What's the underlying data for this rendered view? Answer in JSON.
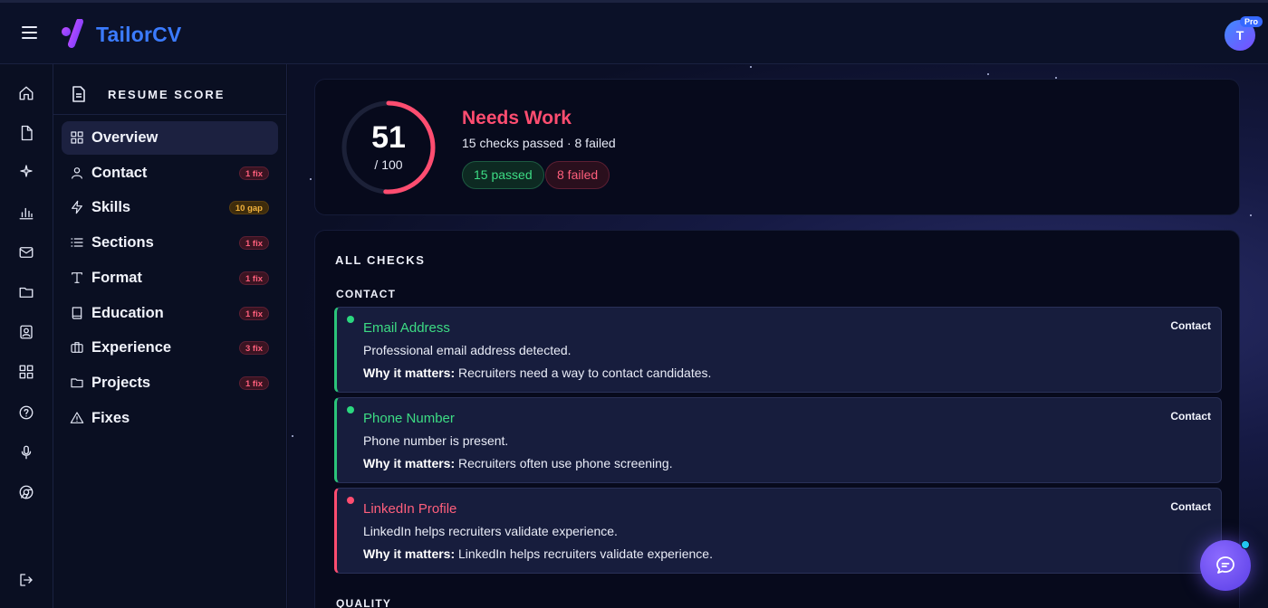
{
  "app": {
    "brand": "TailorCV",
    "user_initial": "T",
    "plan_badge": "Pro",
    "accent": "#3b7bff"
  },
  "sidebar": {
    "title": "RESUME SCORE",
    "items": [
      {
        "label": "Overview",
        "icon": "grid-icon",
        "badge": ""
      },
      {
        "label": "Contact",
        "icon": "user-icon",
        "badge": "1 fix"
      },
      {
        "label": "Skills",
        "icon": "zap-icon",
        "badge": "10 gap"
      },
      {
        "label": "Sections",
        "icon": "list-icon",
        "badge": "1 fix"
      },
      {
        "label": "Format",
        "icon": "type-icon",
        "badge": "1 fix"
      },
      {
        "label": "Education",
        "icon": "book-icon",
        "badge": "1 fix"
      },
      {
        "label": "Experience",
        "icon": "briefcase-icon",
        "badge": "3 fix"
      },
      {
        "label": "Projects",
        "icon": "folder-icon",
        "badge": "1 fix"
      },
      {
        "label": "Fixes",
        "icon": "warning-icon",
        "badge": ""
      }
    ]
  },
  "score": {
    "value": "51",
    "max": "/ 100",
    "fraction": 0.51,
    "status": "Needs Work",
    "summary": "15 checks passed · 8 failed",
    "passed_label": "15 passed",
    "failed_label": "8 failed",
    "status_color": "#ff4d70"
  },
  "checks": {
    "title": "ALL CHECKS",
    "groups": [
      {
        "label": "CONTACT",
        "items": [
          {
            "title": "Email Address",
            "status": "pass",
            "desc": "Professional email address detected.",
            "why_label": "Why it matters:",
            "why": "Recruiters need a way to contact candidates.",
            "tag": "Contact"
          },
          {
            "title": "Phone Number",
            "status": "pass",
            "desc": "Phone number is present.",
            "why_label": "Why it matters:",
            "why": "Recruiters often use phone screening.",
            "tag": "Contact"
          },
          {
            "title": "LinkedIn Profile",
            "status": "fail",
            "desc": "LinkedIn helps recruiters validate experience.",
            "why_label": "Why it matters:",
            "why": "LinkedIn helps recruiters validate experience.",
            "tag": "Contact"
          }
        ]
      },
      {
        "label": "QUALITY",
        "items": []
      }
    ]
  }
}
